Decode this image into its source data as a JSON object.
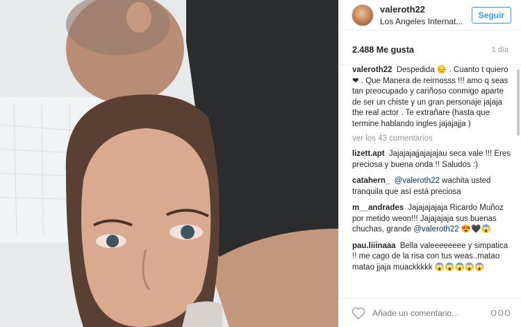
{
  "post": {
    "username": "valeroth22",
    "location": "Los Angeles Internat...",
    "follow_label": "Seguir",
    "likes": "2.488 Me gusta",
    "age": "1 día",
    "view_all_label": "ver los 43 comentarios",
    "comment_placeholder": "Añade un comentario...",
    "more_label": "ooo"
  },
  "caption": {
    "user": "valeroth22",
    "text": "Despedida 😔 . Cuanto t quiero ❤ . Que Manera de reirnosss !!! amo q seas tan preocupado y cariñoso conmigo aparte de ser un chiste y un gran personaje jajaja the real actor . Te extrañare (hasta que termine hablando ingles jajajajja )"
  },
  "comments": [
    {
      "user": "lizett.apt",
      "pre": "Jajajajajjajajajau seca vale !!! Eres preciosa y buena onda !! Saludos :)",
      "mention": "",
      "post": ""
    },
    {
      "user": "catahern_",
      "pre": "",
      "mention": "@valeroth22",
      "post": " wachita usted tranquila que así está preciosa"
    },
    {
      "user": "m__andrades",
      "pre": "Jajajajajaja Ricardo Muñoz por metido weon!!! Jajajajaja sus buenas chuchas, grande ",
      "mention": "@valeroth22",
      "post": " 😍🖤😱"
    },
    {
      "user": "pau.liiinaaa",
      "pre": "Bella valeeeeeeee y simpatica !! me cago de la risa con tus weas..matao matao jjaja muackkkkk 😱😱😱😱😱",
      "mention": "",
      "post": ""
    }
  ],
  "colors": {
    "accent": "#3897f0",
    "mention": "#003569",
    "muted": "#999999",
    "text": "#262626"
  },
  "icons": [
    "heart-icon",
    "more-options-icon",
    "avatar"
  ]
}
